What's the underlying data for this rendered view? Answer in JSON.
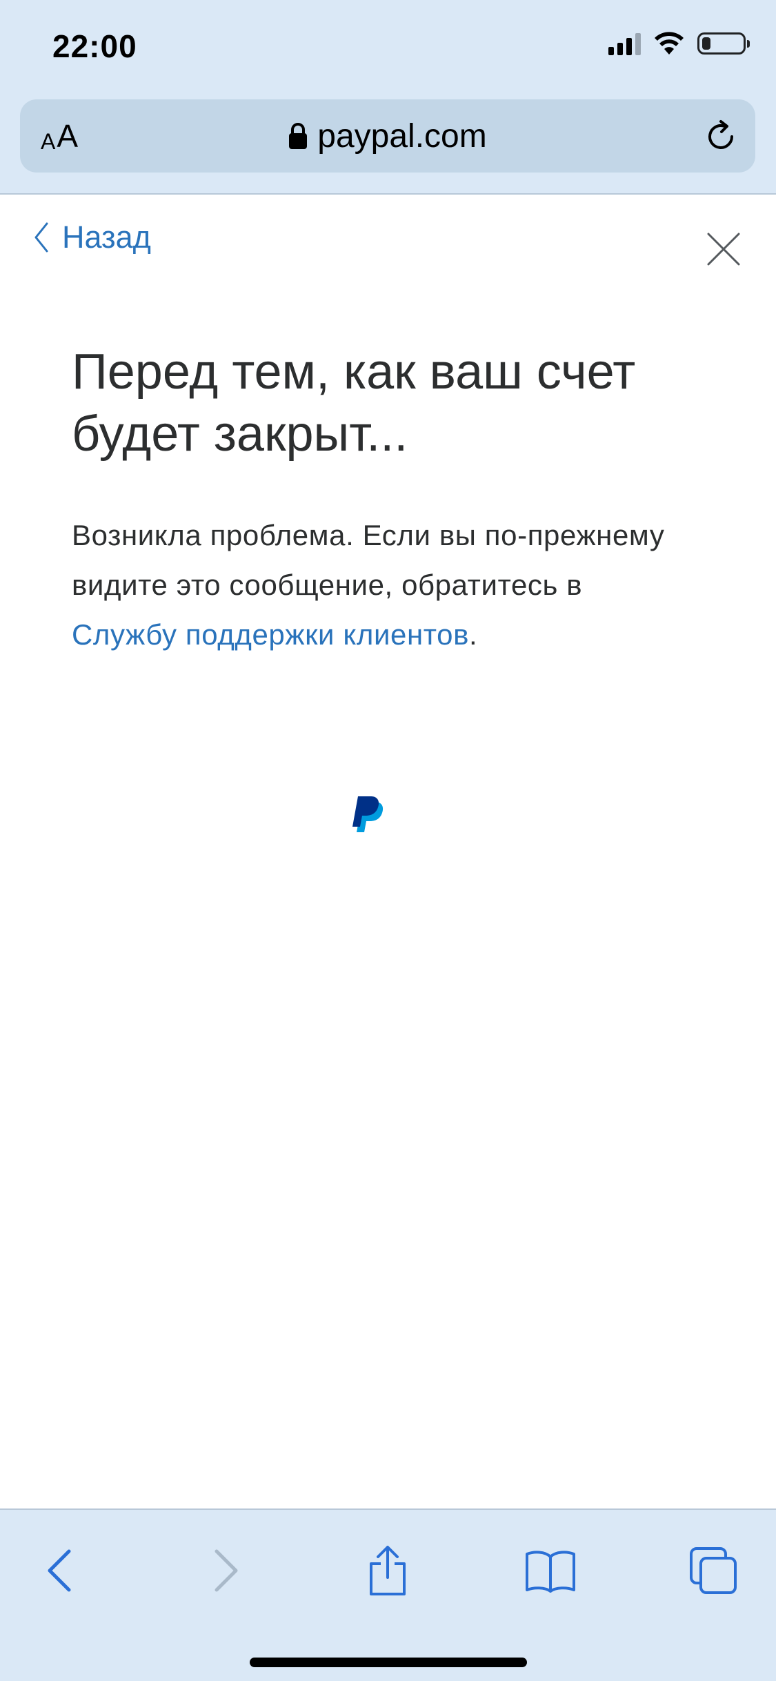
{
  "status_bar": {
    "time": "22:00",
    "battery_level_fraction": 0.2,
    "signal_bars_active": 3,
    "signal_bars_total": 4
  },
  "browser": {
    "text_size_label_small": "A",
    "text_size_label_large": "A",
    "url": "paypal.com",
    "icons": {
      "lock": "lock-icon",
      "reload": "reload-icon",
      "back": "chevron-left-icon",
      "forward": "chevron-right-icon",
      "share": "share-icon",
      "bookmarks": "book-icon",
      "tabs": "tabs-icon"
    },
    "forward_enabled": false
  },
  "page": {
    "back_label": "Назад",
    "title": "Перед тем, как ваш счет будет закрыт...",
    "message_before_link": "Возникла проблема. Если вы по-прежнему видите это сообщение, обратитесь в ",
    "support_link": "Службу поддержки клиентов",
    "message_after_link": "."
  },
  "colors": {
    "chrome_background": "#dae8f6",
    "url_bar_background": "#c2d6e7",
    "link_blue": "#2a73bb",
    "toolbar_blue": "#2a6fd6",
    "paypal_dark_blue": "#003087",
    "paypal_light_blue": "#009cde",
    "text_dark": "#2c2e2f"
  }
}
